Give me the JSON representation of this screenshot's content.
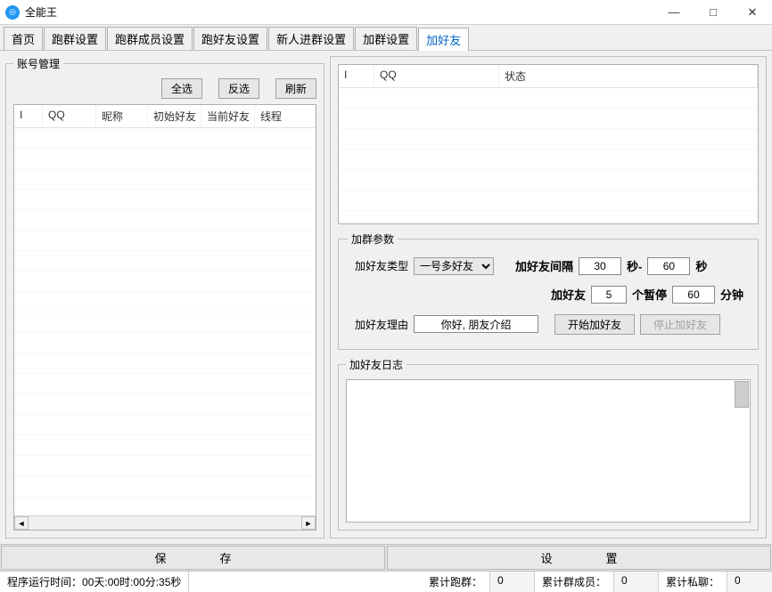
{
  "window": {
    "title": "全能王",
    "min": "—",
    "max": "□",
    "close": "✕"
  },
  "tabs": [
    "首页",
    "跑群设置",
    "跑群成员设置",
    "跑好友设置",
    "新人进群设置",
    "加群设置",
    "加好友"
  ],
  "active_tab_index": 6,
  "left": {
    "legend": "账号管理",
    "buttons": {
      "select_all": "全选",
      "invert": "反选",
      "refresh": "刷新"
    },
    "columns": [
      "I",
      "QQ",
      "昵称",
      "初始好友",
      "当前好友",
      "线程"
    ]
  },
  "right": {
    "top_columns": [
      "I",
      "QQ",
      "状态"
    ],
    "params": {
      "legend": "加群参数",
      "type_label": "加好友类型",
      "type_value": "一号多好友",
      "interval_label": "加好友间隔",
      "interval_from": "30",
      "sec_dash": "秒-",
      "interval_to": "60",
      "sec": "秒",
      "add_label": "加好友",
      "add_count": "5",
      "pause_label": "个暂停",
      "pause_minutes": "60",
      "minutes": "分钟",
      "reason_label": "加好友理由",
      "reason_value": "你好, 朋友介绍",
      "start": "开始加好友",
      "stop": "停止加好友"
    },
    "log_legend": "加好友日志"
  },
  "footer": {
    "save": "保存",
    "settings": "设置"
  },
  "status": {
    "runtime_label": "程序运行时间：",
    "runtime_value": "00天:00时:00分:35秒",
    "run_group_label": "累计跑群：",
    "run_group_value": "0",
    "group_member_label": "累计群成员：",
    "group_member_value": "0",
    "private_label": "累计私聊：",
    "private_value": "0"
  }
}
